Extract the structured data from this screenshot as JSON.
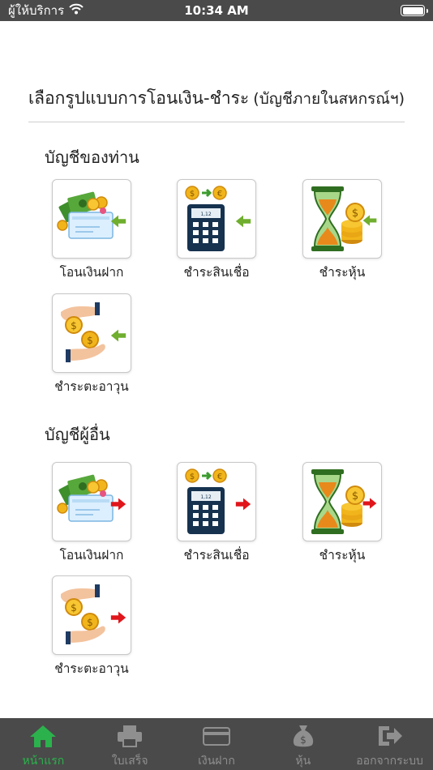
{
  "status_bar": {
    "carrier": "ผู้ให้บริการ",
    "time": "10:34 AM"
  },
  "header": {
    "title": "เลือกรูปแบบการโอนเงิน-ชำระ",
    "subtitle": "(บัญชีภายในสหกรณ์ฯ)"
  },
  "sections": {
    "own": {
      "title": "บัญชีของท่าน",
      "items": [
        {
          "label": "โอนเงินฝาก"
        },
        {
          "label": "ชำระสินเชื่อ"
        },
        {
          "label": "ชำระหุ้น"
        },
        {
          "label": "ชำระตะอาวุน"
        }
      ]
    },
    "other": {
      "title": "บัญชีผู้อื่น",
      "items": [
        {
          "label": "โอนเงินฝาก"
        },
        {
          "label": "ชำระสินเชื่อ"
        },
        {
          "label": "ชำระหุ้น"
        },
        {
          "label": "ชำระตะอาวุน"
        }
      ]
    }
  },
  "calculator_display": "1,12",
  "icons": {
    "own_arrow": "green-left-arrow-icon",
    "other_arrow": "red-right-arrow-icon"
  },
  "colors": {
    "status_bar": "#4a4a4a",
    "tab_bar": "#4a4a4a",
    "tab_active": "#2bb24c",
    "tab_inactive": "#8f8f8f",
    "arrow_green": "#6fae2e",
    "arrow_red": "#e0161b"
  },
  "tabs": [
    {
      "label": "หน้าแรก",
      "active": true
    },
    {
      "label": "ใบเสร็จ",
      "active": false
    },
    {
      "label": "เงินฝาก",
      "active": false
    },
    {
      "label": "หุ้น",
      "active": false
    },
    {
      "label": "ออกจากระบบ",
      "active": false
    }
  ]
}
